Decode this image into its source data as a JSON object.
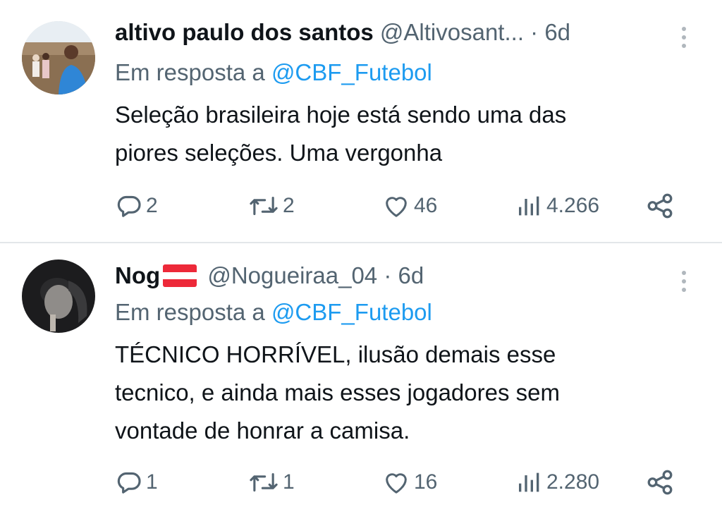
{
  "tweets": [
    {
      "name": "altivo paulo dos santos",
      "handle": "@Altivosant...",
      "separator": "·",
      "time": "6d",
      "reply_prefix": "Em resposta a",
      "reply_to": "@CBF_Futebol",
      "text_lines": [
        "Seleção brasileira hoje está sendo uma das",
        "piores seleções. Uma vergonha"
      ],
      "replies": "2",
      "retweets": "2",
      "likes": "46",
      "views": "4.266"
    },
    {
      "name": "Nog",
      "handle": "@Nogueiraa_04",
      "separator": "·",
      "time": "6d",
      "reply_prefix": "Em resposta a",
      "reply_to": "@CBF_Futebol",
      "text_lines": [
        "TÉCNICO HORRÍVEL, ilusão demais esse",
        "tecnico, e ainda mais esses jogadores sem",
        "vontade de honrar a camisa."
      ],
      "replies": "1",
      "retweets": "1",
      "likes": "16",
      "views": "2.280"
    }
  ],
  "icons": {
    "reply": "speech-bubble-icon",
    "retweet": "retweet-icon",
    "like": "heart-icon",
    "views": "bar-chart-icon",
    "share": "share-icon",
    "more": "vertical-ellipsis-icon",
    "flag": "austria-flag-icon"
  },
  "colors": {
    "text": "#0f1419",
    "secondary": "#536471",
    "link": "#1d9bf0",
    "divider": "#e3e6e9",
    "flag_red": "#ed2939"
  }
}
